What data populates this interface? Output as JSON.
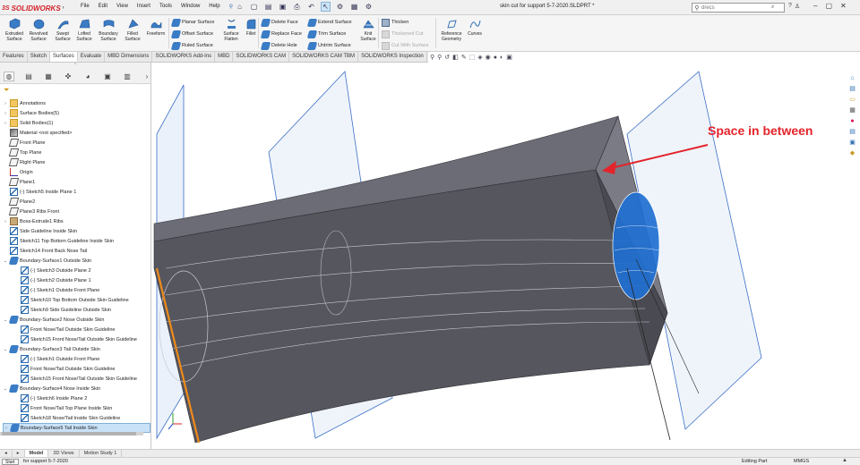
{
  "app": {
    "brand": "SOLIDWORKS",
    "brand_mark": "3S",
    "document_title": "skin cut for support 5-7-2020.SLDPRT *"
  },
  "menu": [
    "File",
    "Edit",
    "View",
    "Insert",
    "Tools",
    "Window",
    "Help"
  ],
  "search": {
    "placeholder": "drecs"
  },
  "ribbon": {
    "big_tools": [
      {
        "label": "Extruded Surface",
        "icon": "extruded-surface-icon"
      },
      {
        "label": "Revolved Surface",
        "icon": "revolved-surface-icon"
      },
      {
        "label": "Swept Surface",
        "icon": "swept-surface-icon"
      },
      {
        "label": "Lofted Surface",
        "icon": "lofted-surface-icon"
      },
      {
        "label": "Boundary Surface",
        "icon": "boundary-surface-icon"
      },
      {
        "label": "Filled Surface",
        "icon": "filled-surface-icon"
      },
      {
        "label": "Freeform",
        "icon": "freeform-icon"
      }
    ],
    "group1": [
      "Planar Surface",
      "Offset Surface",
      "Ruled Surface"
    ],
    "surface_flatten": "Surface Flatten",
    "fillet": "Fillet",
    "group2": [
      "Delete Face",
      "Replace Face",
      "Delete Hole"
    ],
    "group3": [
      "Extend Surface",
      "Trim Surface",
      "Untrim Surface"
    ],
    "knit_surface": "Knit Surface",
    "group4": [
      "Thicken",
      "Thickened Cut",
      "Cut With Surface"
    ],
    "reference_geometry": "Reference Geometry",
    "curves": "Curves"
  },
  "tabs": [
    "Features",
    "Sketch",
    "Surfaces",
    "Evaluate",
    "MBD Dimensions",
    "SOLIDWORKS Add-Ins",
    "MBD",
    "SOLIDWORKS CAM",
    "SOLIDWORKS CAM TBM",
    "SOLIDWORKS Inspection"
  ],
  "active_tab": "Surfaces",
  "tree": [
    {
      "label": "Annotations",
      "icon": "annotations-icon",
      "level": 0,
      "expander": ">"
    },
    {
      "label": "Surface Bodies(5)",
      "icon": "surface-bodies-folder-icon",
      "level": 0,
      "expander": ">"
    },
    {
      "label": "Solid Bodies(1)",
      "icon": "solid-bodies-folder-icon",
      "level": 0,
      "expander": ">"
    },
    {
      "label": "Material <not specified>",
      "icon": "material-icon",
      "level": 0,
      "expander": ""
    },
    {
      "label": "Front Plane",
      "icon": "plane-icon",
      "level": 0,
      "expander": ""
    },
    {
      "label": "Top Plane",
      "icon": "plane-icon",
      "level": 0,
      "expander": ""
    },
    {
      "label": "Right Plane",
      "icon": "plane-icon",
      "level": 0,
      "expander": ""
    },
    {
      "label": "Origin",
      "icon": "origin-icon",
      "level": 0,
      "expander": ""
    },
    {
      "label": "Plane1",
      "icon": "plane-icon",
      "level": 0,
      "expander": ""
    },
    {
      "label": "(-) Sketch5 Inside Plane 1",
      "icon": "sketch-icon",
      "level": 0,
      "expander": ""
    },
    {
      "label": "Plane2",
      "icon": "plane-icon",
      "level": 0,
      "expander": ""
    },
    {
      "label": "Plane3 Ribs Front",
      "icon": "plane-icon",
      "level": 0,
      "expander": ""
    },
    {
      "label": "Boss-Extrude1 Ribs",
      "icon": "boss-extrude-icon",
      "level": 0,
      "expander": ">"
    },
    {
      "label": "Side Guideline Inside Skin",
      "icon": "sketch-icon",
      "level": 0,
      "expander": ""
    },
    {
      "label": "Sketch11 Top Bottom Guideline Inside Skin",
      "icon": "sketch-icon",
      "level": 0,
      "expander": ""
    },
    {
      "label": "Sketch14 Front Back Nose Tail",
      "icon": "sketch-icon",
      "level": 0,
      "expander": ""
    },
    {
      "label": "Boundary-Surface1 Outside Skin",
      "icon": "boundary-surface-icon",
      "level": 0,
      "expander": "v"
    },
    {
      "label": "(-) Sketch3 Outside Plane 2",
      "icon": "sketch-icon",
      "level": 1,
      "expander": ""
    },
    {
      "label": "(-) Sketch2 Outside Plane 1",
      "icon": "sketch-icon",
      "level": 1,
      "expander": ""
    },
    {
      "label": "(-) Sketch1 Outside Front Plane",
      "icon": "sketch-icon",
      "level": 1,
      "expander": ""
    },
    {
      "label": "Sketch10 Top Bottom Outside Skin Guideline",
      "icon": "sketch-icon",
      "level": 1,
      "expander": ""
    },
    {
      "label": "Sketch9 Side Guideline Outside Skin",
      "icon": "sketch-icon",
      "level": 1,
      "expander": ""
    },
    {
      "label": "Boundary-Surface2 Nose Outside Skin",
      "icon": "boundary-surface-icon",
      "level": 0,
      "expander": "v"
    },
    {
      "label": "Front Nose/Tail Outside Skin Guideline",
      "icon": "sketch-icon",
      "level": 1,
      "expander": ""
    },
    {
      "label": "Sketch15 Front Nose/Tail Outside Skin Guideline",
      "icon": "sketch-icon",
      "level": 1,
      "expander": ""
    },
    {
      "label": "Boundary-Surface3 Tail Outside Skin",
      "icon": "boundary-surface-icon",
      "level": 0,
      "expander": "v"
    },
    {
      "label": "(-) Sketch1 Outside Front Plane",
      "icon": "sketch-icon",
      "level": 1,
      "expander": ""
    },
    {
      "label": "Front Nose/Tail Outside Skin Guideline",
      "icon": "sketch-icon",
      "level": 1,
      "expander": ""
    },
    {
      "label": "Sketch15 Front Nose/Tail Outside Skin Guideline",
      "icon": "sketch-icon",
      "level": 1,
      "expander": ""
    },
    {
      "label": "Boundary-Surface4 Nose Inside Skin",
      "icon": "boundary-surface-icon",
      "level": 0,
      "expander": "v"
    },
    {
      "label": "(-) Sketch6 Inside Plane 2",
      "icon": "sketch-icon",
      "level": 1,
      "expander": ""
    },
    {
      "label": "Front Nose/Tail Top Plane Inside Skin",
      "icon": "sketch-icon",
      "level": 1,
      "expander": ""
    },
    {
      "label": "Sketch18 Nose/Tail Inside Skin Guideline",
      "icon": "sketch-icon",
      "level": 1,
      "expander": ""
    },
    {
      "label": "Boundary-Surface5 Tail Inside Skin",
      "icon": "boundary-surface-icon",
      "level": 0,
      "expander": ">",
      "selected": true
    }
  ],
  "viewport": {
    "callout": "Space in between"
  },
  "bottom_tabs": [
    "Model",
    "3D Views",
    "Motion Study 1"
  ],
  "active_bottom_tab": "Model",
  "status": {
    "start": "Start",
    "message": "for support 5-7-2020",
    "mode": "Editing Part",
    "units": "MMGS",
    "unit_arrow": "▲"
  },
  "colors": {
    "brand": "#d2232a",
    "callout": "#e3242b",
    "selection": "#c9e2f7",
    "surface": "#55565e",
    "highlight_surface": "#1f6fd1"
  }
}
